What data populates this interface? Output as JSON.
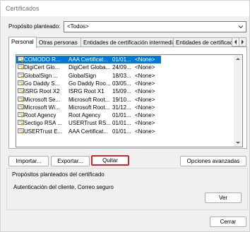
{
  "window": {
    "title": "Certificados"
  },
  "purpose": {
    "label": "Propósito planteado:",
    "value": "<Todos>"
  },
  "tabs": [
    {
      "label": "Personal",
      "active": true
    },
    {
      "label": "Otras personas",
      "active": false
    },
    {
      "label": "Entidades de certificación intermedias",
      "active": false
    },
    {
      "label": "Entidades de certificac",
      "active": false
    }
  ],
  "certificates": [
    {
      "issued_to": "COMODO R...",
      "issued_by": "AAA Certificat...",
      "date": "01/01...",
      "name": "<None>",
      "selected": true
    },
    {
      "issued_to": "DigiCert Glo...",
      "issued_by": "DigiCert Globa...",
      "date": "24/09...",
      "name": "<None>",
      "selected": false
    },
    {
      "issued_to": "GlobalSign ...",
      "issued_by": "GlobalSign",
      "date": "18/03...",
      "name": "<None>",
      "selected": false
    },
    {
      "issued_to": "Go Daddy S...",
      "issued_by": "Go Daddy Roo...",
      "date": "03/05...",
      "name": "<None>",
      "selected": false
    },
    {
      "issued_to": "ISRG Root X2",
      "issued_by": "ISRG Root X1",
      "date": "15/09...",
      "name": "<None>",
      "selected": false
    },
    {
      "issued_to": "Microsoft Se...",
      "issued_by": "Microsoft Root...",
      "date": "19/10...",
      "name": "<None>",
      "selected": false
    },
    {
      "issued_to": "Microsoft Wi...",
      "issued_by": "Microsoft Root...",
      "date": "31/12...",
      "name": "<None>",
      "selected": false
    },
    {
      "issued_to": "Root Agency",
      "issued_by": "Root Agency",
      "date": "01/01...",
      "name": "<None>",
      "selected": false
    },
    {
      "issued_to": "Sectigo RSA ...",
      "issued_by": "USERTrust RS...",
      "date": "01/01...",
      "name": "<None>",
      "selected": false
    },
    {
      "issued_to": "USERTrust E...",
      "issued_by": "AAA Certificat...",
      "date": "01/01...",
      "name": "<None>",
      "selected": false
    }
  ],
  "buttons": {
    "import": "Importar...",
    "export": "Exportar...",
    "remove": "Quitar",
    "advanced": "Opciones avanzadas",
    "view": "Ver",
    "close": "Cerrar"
  },
  "purposes_group": {
    "title": "Propósitos planteados del certificado",
    "value": "Autenticación del cliente, Correo seguro"
  },
  "colors": {
    "selection": "#0078d7",
    "focus_border": "#d22424"
  }
}
